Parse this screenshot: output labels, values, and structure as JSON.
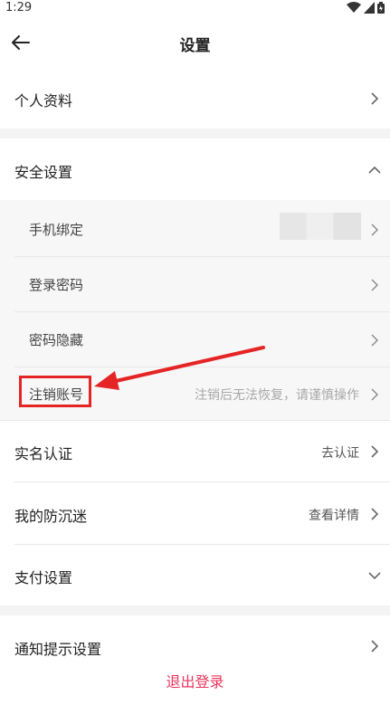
{
  "status_bar": {
    "time": "1:29",
    "icons": [
      "wifi-icon",
      "signal-icon",
      "battery-icon"
    ]
  },
  "nav": {
    "title": "设置",
    "back_icon": "arrow-left-icon"
  },
  "rows": {
    "profile": {
      "label": "个人资料"
    },
    "security": {
      "label": "安全设置",
      "expanded": true
    },
    "real_name": {
      "label": "实名认证",
      "value": "去认证"
    },
    "anti_addiction": {
      "label": "我的防沉迷",
      "value": "查看详情"
    },
    "payment": {
      "label": "支付设置"
    },
    "notifications": {
      "label": "通知提示设置"
    }
  },
  "security_items": {
    "phone_binding": {
      "label": "手机绑定"
    },
    "login_password": {
      "label": "登录密码"
    },
    "password_hiding": {
      "label": "密码隐藏"
    },
    "cancel_account": {
      "label": "注销账号",
      "hint": "注销后无法恢复，请谨慎操作"
    }
  },
  "logout": {
    "label": "退出登录"
  },
  "colors": {
    "accent": "#e8365d",
    "annotation": "#e52525",
    "section_bg": "#f7f7f7",
    "gap_bg": "#f4f4f4"
  }
}
